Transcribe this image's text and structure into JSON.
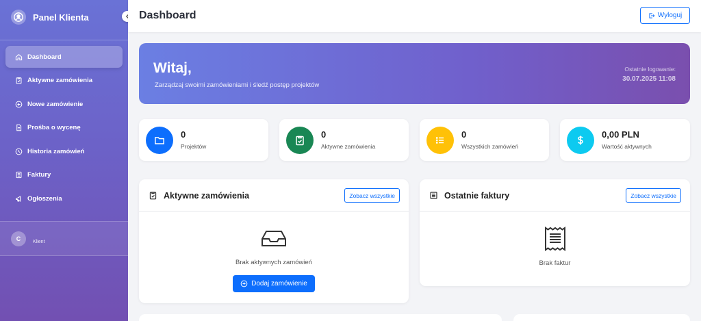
{
  "sidebar": {
    "brand_title": "Panel Klienta",
    "items": [
      {
        "label": "Dashboard",
        "icon": "home-icon"
      },
      {
        "label": "Aktywne zamówienia",
        "icon": "clipboard-check-icon"
      },
      {
        "label": "Nowe zamówienie",
        "icon": "plus-circle-icon"
      },
      {
        "label": "Prośba o wycenę",
        "icon": "file-text-icon"
      },
      {
        "label": "Historia zamówień",
        "icon": "clock-icon"
      },
      {
        "label": "Faktury",
        "icon": "receipt-icon"
      },
      {
        "label": "Ogłoszenia",
        "icon": "megaphone-icon"
      }
    ],
    "user_initial": "C",
    "user_role": "Klient"
  },
  "header": {
    "title": "Dashboard",
    "logout_label": "Wyloguj"
  },
  "welcome": {
    "title": "Witaj,",
    "subtitle": "Zarządzaj swoimi zamówieniami i śledź postęp projektów",
    "last_login_label": "Ostatnie logowanie:",
    "last_login_date": "30.07.2025 11:08"
  },
  "stats": [
    {
      "value": "0",
      "label": "Projektów",
      "color": "#0d6efd",
      "icon": "folder-icon"
    },
    {
      "value": "0",
      "label": "Aktywne zamówienia",
      "color": "#198754",
      "icon": "clipboard-check-icon"
    },
    {
      "value": "0",
      "label": "Wszystkich zamówień",
      "color": "#ffc107",
      "icon": "list-icon"
    },
    {
      "value": "0,00 PLN",
      "label": "Wartość aktywnych",
      "color": "#0dcaf0",
      "icon": "dollar-icon"
    }
  ],
  "active_orders": {
    "title": "Aktywne zamówienia",
    "link_label": "Zobacz wszystkie",
    "empty_text": "Brak aktywnych zamówień",
    "add_button": "Dodaj zamówienie"
  },
  "invoices": {
    "title": "Ostatnie faktury",
    "link_label": "Zobacz wszystkie",
    "empty_text": "Brak faktur"
  },
  "colors": {
    "accent": "#0d6efd",
    "sidebar_top": "#6a72d6",
    "sidebar_bottom": "#7250b2"
  }
}
